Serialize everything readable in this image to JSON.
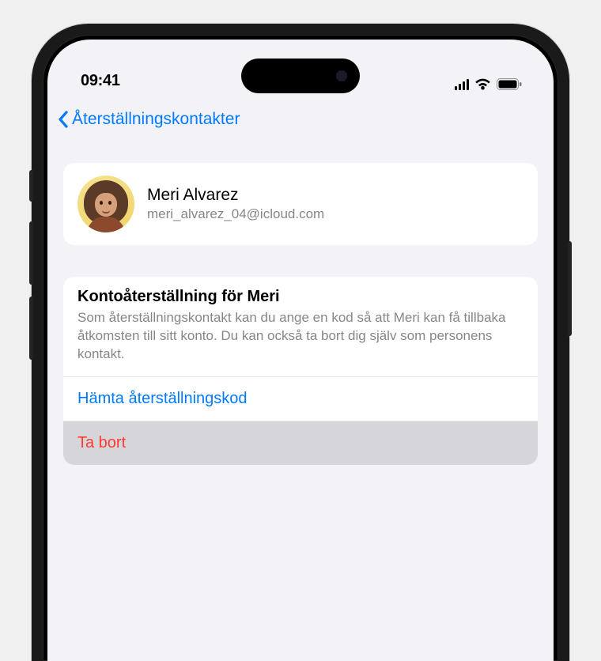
{
  "status_bar": {
    "time": "09:41"
  },
  "nav": {
    "back_label": "Återställningskontakter"
  },
  "contact": {
    "name": "Meri Alvarez",
    "email": "meri_alvarez_04@icloud.com"
  },
  "recovery_section": {
    "title": "Kontoåterställning för Meri",
    "description": "Som återställningskontakt kan du ange en kod så att Meri kan få tillbaka åtkomsten till sitt konto. Du kan också ta bort dig själv som personens kontakt.",
    "get_code_label": "Hämta återställningskod",
    "remove_label": "Ta bort"
  },
  "colors": {
    "blue": "#007aff",
    "red": "#ff3b30",
    "secondary_text": "#86868b",
    "grouped_bg": "#f2f2f7"
  }
}
